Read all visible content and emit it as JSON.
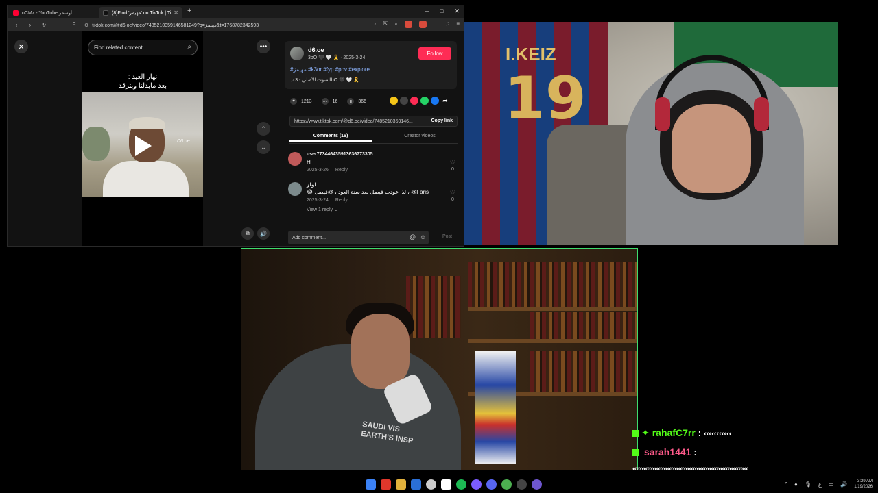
{
  "browser": {
    "tabs": [
      {
        "label": "oCMz - YouTube أوسمز",
        "active": false,
        "favicon_color": "#ff0033"
      },
      {
        "label": "(8)Find 'مهيمز' on TikTok | TikTok",
        "active": true,
        "favicon_color": "#111111"
      }
    ],
    "new_tab": "+",
    "window_buttons": {
      "minimize": "–",
      "maximize": "□",
      "close": "✕"
    },
    "url": "tiktok.com/@d6.oe/video/7485210359146581249?q=مهيمز&t=1768782342593"
  },
  "tiktok": {
    "search_placeholder": "Find related content",
    "video_caption_line1": "نهار العيد :",
    "video_caption_line2": "بعد مابدلنا وبترقد",
    "watermark": "D6.oe",
    "author": {
      "username": "d6.oe",
      "meta": "3bO 🖤 🤍 🎗️ · 2025-3-24"
    },
    "follow_label": "Follow",
    "hashtags": "#مهيمز #k3or #fyp #pov #explore",
    "music": "♫  الصوت الأصلي - 3bO 🖤 🤍 🎗️ .",
    "stats": {
      "likes": "1213",
      "comments": "16",
      "saves": "366"
    },
    "share_colors": [
      "#f5c518",
      "#444444",
      "#fe2c55",
      "#25d366",
      "#1877f2",
      "#121212"
    ],
    "link": "https://www.tiktok.com/@d6.oe/video/7485210359146...",
    "copy_link_label": "Copy link",
    "tabs": {
      "comments": "Comments (16)",
      "creator": "Creator videos"
    },
    "comments": [
      {
        "user": "user7734464359136367​73305",
        "text": "Hi",
        "date": "2025-3-26",
        "reply": "Reply",
        "likes": "0",
        "avatar_color": "#c05a5a"
      },
      {
        "user": "لولز",
        "text": "😂 لذا عودت فيصل بعد سنة العود ، @فيصل ، @Faris",
        "date": "2025-3-24",
        "reply": "Reply",
        "likes": "0",
        "view_replies": "View 1 reply ⌄",
        "avatar_color": "#7c8a8c"
      }
    ],
    "add_comment_placeholder": "Add comment...",
    "post_label": "Post"
  },
  "chat": {
    "line1_user": "rahafC7rr",
    "line1_msg": "‹‹‹‹‹‹‹‹‹‹‹",
    "line1_color": "#53fc18",
    "line2_user": "sarah1441",
    "line2_color": "#ff5a8a",
    "line3": "‹‹‹‹‹‹‹‹‹‹‹‹‹‹‹‹‹‹‹‹‹‹‹‹‹‹‹‹‹‹‹‹‹‹‹‹‹‹‹‹‹‹‹‹‹‹‹‹‹‹‹‹‹‹‹‹‹‹‹‹‹‹‹",
    "line4": "‹‹‹‹‹‹‹‹‹‹‹‹‹‹‹‹‹"
  },
  "taskbar": {
    "icon_colors": [
      "#3b82f6",
      "#e0372b",
      "#e2b13c",
      "#2a6fd6",
      "#cccccc",
      "#ffffff",
      "#1db954",
      "#7b5cff",
      "#5865f2",
      "#4caf50",
      "#444444",
      "#6e56cf"
    ],
    "lang": "ع",
    "time": "3:29 AM",
    "date": "1/19/2026"
  }
}
